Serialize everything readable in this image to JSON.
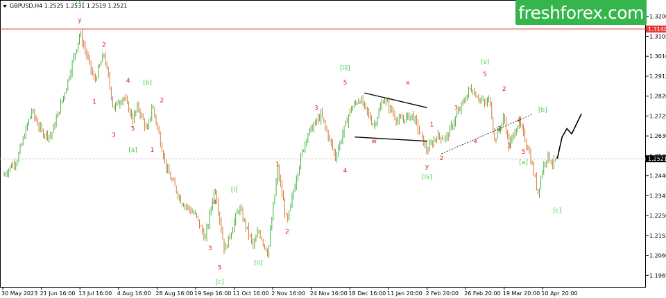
{
  "brand": {
    "logo_text": "freshforex.com",
    "color": "#35b54b"
  },
  "colors": {
    "up": "#2eac29",
    "down": "#d2691e",
    "wave_red": "#e0201b",
    "wave_green": "#3ec83a",
    "level": "#e53935",
    "marker": "#000000"
  },
  "chart_data": {
    "type": "candlestick",
    "symbol_header": "GBPUSD,H4  1.2525 1.2531 1.2519 1.2521",
    "current_price": "1.2521",
    "level_price": "1.3140",
    "level_value": 1.314,
    "current_value": 1.2521,
    "ylim": [
      1.191,
      1.3275
    ],
    "y_ticks": [
      "1.3200",
      "1.3105",
      "1.3010",
      "1.2915",
      "1.2820",
      "1.2725",
      "1.2630",
      "1.2535",
      "1.2440",
      "1.2345",
      "1.2250",
      "1.2155",
      "1.2060",
      "1.1965"
    ],
    "y_tick_values": [
      1.32,
      1.3105,
      1.301,
      1.2915,
      1.282,
      1.2725,
      1.263,
      1.2535,
      1.244,
      1.2345,
      1.225,
      1.2155,
      1.206,
      1.1965
    ],
    "x_ticks": [
      "30 May 2023",
      "21 Jun 16:00",
      "13 Jul 16:00",
      "4 Aug 16:00",
      "28 Aug 16:00",
      "19 Sep 16:00",
      "11 Oct 16:00",
      "2 Nov 16:00",
      "24 Nov 16:00",
      "18 Dec 16:00",
      "11 Jan 20:00",
      "2 Feb 20:00",
      "26 Feb 20:00",
      "19 Mar 20:00",
      "10 Apr 20:00"
    ],
    "x_tick_index": [
      0,
      8,
      16,
      24,
      32,
      40,
      48,
      56,
      64,
      72,
      80,
      88,
      96,
      104,
      112
    ],
    "price_path": [
      [
        0,
        1.244
      ],
      [
        3,
        1.252
      ],
      [
        6,
        1.275
      ],
      [
        8,
        1.265
      ],
      [
        10,
        1.263
      ],
      [
        13,
        1.285
      ],
      [
        16,
        1.312
      ],
      [
        18,
        1.297
      ],
      [
        19,
        1.289
      ],
      [
        21,
        1.302
      ],
      [
        23,
        1.276
      ],
      [
        25,
        1.282
      ],
      [
        27,
        1.271
      ],
      [
        28,
        1.277
      ],
      [
        30,
        1.265
      ],
      [
        31,
        1.278
      ],
      [
        34,
        1.247
      ],
      [
        37,
        1.232
      ],
      [
        40,
        1.225
      ],
      [
        42,
        1.214
      ],
      [
        44,
        1.239
      ],
      [
        46,
        1.208
      ],
      [
        49,
        1.229
      ],
      [
        52,
        1.21
      ],
      [
        53,
        1.218
      ],
      [
        55,
        1.207
      ],
      [
        57,
        1.247
      ],
      [
        59,
        1.221
      ],
      [
        61,
        1.245
      ],
      [
        63,
        1.263
      ],
      [
        66,
        1.273
      ],
      [
        69,
        1.253
      ],
      [
        72,
        1.275
      ],
      [
        74,
        1.281
      ],
      [
        77,
        1.268
      ],
      [
        79,
        1.281
      ],
      [
        82,
        1.27
      ],
      [
        85,
        1.273
      ],
      [
        88,
        1.256
      ],
      [
        90,
        1.263
      ],
      [
        92,
        1.262
      ],
      [
        94,
        1.272
      ],
      [
        97,
        1.286
      ],
      [
        100,
        1.278
      ],
      [
        101,
        1.281
      ],
      [
        102,
        1.261
      ],
      [
        104,
        1.272
      ],
      [
        105,
        1.258
      ],
      [
        107,
        1.27
      ],
      [
        109,
        1.257
      ],
      [
        111,
        1.236
      ],
      [
        112,
        1.248
      ],
      [
        113,
        1.254
      ],
      [
        114,
        1.25
      ],
      [
        115,
        1.252
      ]
    ],
    "forecast_path": [
      [
        115,
        1.2521
      ],
      [
        116,
        1.2625
      ],
      [
        117,
        1.2665
      ],
      [
        118,
        1.264
      ],
      [
        120,
        1.2735
      ]
    ],
    "wave_labels": [
      {
        "text": "[y]",
        "i": 16,
        "p": 1.3265,
        "color": "green"
      },
      {
        "text": "y",
        "i": 16,
        "p": 1.3175,
        "color": "red"
      },
      {
        "text": "2",
        "i": 21,
        "p": 1.3055,
        "color": "red"
      },
      {
        "text": "1",
        "i": 19,
        "p": 1.2785,
        "color": "red"
      },
      {
        "text": "4",
        "i": 26,
        "p": 1.2885,
        "color": "red"
      },
      {
        "text": "[b]",
        "i": 30,
        "p": 1.2875,
        "color": "green"
      },
      {
        "text": "2",
        "i": 33,
        "p": 1.279,
        "color": "red"
      },
      {
        "text": "3",
        "i": 23,
        "p": 1.2625,
        "color": "red"
      },
      {
        "text": "5",
        "i": 27,
        "p": 1.2655,
        "color": "red"
      },
      {
        "text": "[a]",
        "i": 27,
        "p": 1.2555,
        "color": "green"
      },
      {
        "text": "1",
        "i": 31,
        "p": 1.2555,
        "color": "red"
      },
      {
        "text": "4",
        "i": 44,
        "p": 1.2305,
        "color": "red"
      },
      {
        "text": "3",
        "i": 43,
        "p": 1.2085,
        "color": "red"
      },
      {
        "text": "5",
        "i": 45,
        "p": 1.1995,
        "color": "red"
      },
      {
        "text": "[c]",
        "i": 45,
        "p": 1.1925,
        "color": "green"
      },
      {
        "text": "[i]",
        "i": 48,
        "p": 1.2365,
        "color": "green"
      },
      {
        "text": "[ii]",
        "i": 53,
        "p": 1.2015,
        "color": "green"
      },
      {
        "text": "1",
        "i": 57,
        "p": 1.2485,
        "color": "red"
      },
      {
        "text": "2",
        "i": 59,
        "p": 1.2165,
        "color": "red"
      },
      {
        "text": "3",
        "i": 65,
        "p": 1.2755,
        "color": "red"
      },
      {
        "text": "4",
        "i": 71,
        "p": 1.2455,
        "color": "red"
      },
      {
        "text": "5",
        "i": 71,
        "p": 1.2875,
        "color": "red"
      },
      {
        "text": "[iii]",
        "i": 71,
        "p": 1.2945,
        "color": "green"
      },
      {
        "text": "x",
        "i": 84,
        "p": 1.2875,
        "color": "red"
      },
      {
        "text": "w",
        "i": 77,
        "p": 1.2595,
        "color": "red"
      },
      {
        "text": "y",
        "i": 88,
        "p": 1.2475,
        "color": "red"
      },
      {
        "text": "[iv]",
        "i": 88,
        "p": 1.2425,
        "color": "green"
      },
      {
        "text": "1",
        "i": 89,
        "p": 1.2675,
        "color": "red"
      },
      {
        "text": "2",
        "i": 91,
        "p": 1.2515,
        "color": "red"
      },
      {
        "text": "3",
        "i": 94,
        "p": 1.2755,
        "color": "red"
      },
      {
        "text": "4",
        "i": 98,
        "p": 1.2595,
        "color": "red"
      },
      {
        "text": "[v]",
        "i": 100,
        "p": 1.2975,
        "color": "green"
      },
      {
        "text": "5",
        "i": 100,
        "p": 1.2915,
        "color": "red"
      },
      {
        "text": "2",
        "i": 104,
        "p": 1.2845,
        "color": "red"
      },
      {
        "text": "1",
        "i": 103,
        "p": 1.2655,
        "color": "red"
      },
      {
        "text": "4",
        "i": 107,
        "p": 1.2695,
        "color": "red"
      },
      {
        "text": "3",
        "i": 105,
        "p": 1.2575,
        "color": "red"
      },
      {
        "text": "[b]",
        "i": 112,
        "p": 1.2745,
        "color": "green"
      },
      {
        "text": "5",
        "i": 108,
        "p": 1.2545,
        "color": "red"
      },
      {
        "text": "[a]",
        "i": 108,
        "p": 1.2495,
        "color": "green"
      },
      {
        "text": "[c]",
        "i": 115,
        "p": 1.2265,
        "color": "green"
      }
    ],
    "trend_lines": [
      {
        "from": [
          75,
          1.2835
        ],
        "to": [
          88,
          1.2765
        ],
        "style": "solid"
      },
      {
        "from": [
          73,
          1.2625
        ],
        "to": [
          88,
          1.2605
        ],
        "style": "solid"
      },
      {
        "from": [
          91,
          1.2545
        ],
        "to": [
          110,
          1.2735
        ],
        "style": "dotted"
      }
    ]
  }
}
